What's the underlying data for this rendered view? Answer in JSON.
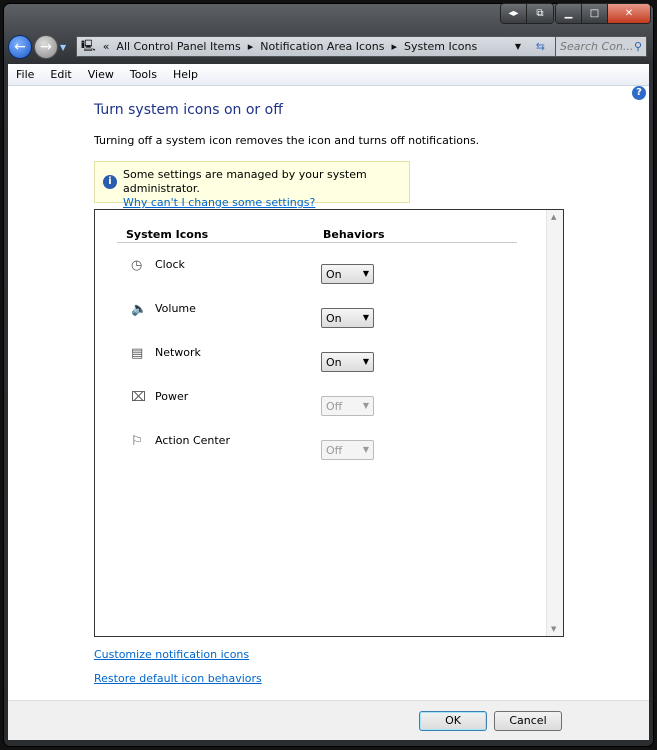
{
  "window": {
    "caption_buttons": [
      "restore-layout",
      "snap",
      "minimize",
      "maximize",
      "close"
    ]
  },
  "address": {
    "overflow": "«",
    "crumbs": [
      "All Control Panel Items",
      "Notification Area Icons",
      "System Icons"
    ],
    "search_placeholder": "Search Con..."
  },
  "menu": [
    "File",
    "Edit",
    "View",
    "Tools",
    "Help"
  ],
  "main": {
    "title": "Turn system icons on or off",
    "description": "Turning off a system icon removes the icon and turns off notifications.",
    "info_text": "Some settings are managed by your system administrator.",
    "info_link": "Why can't I change some settings?",
    "col_icons": "System Icons",
    "col_behaviors": "Behaviors",
    "rows": [
      {
        "name": "Clock",
        "icon": "clock-icon",
        "value": "On",
        "enabled": true
      },
      {
        "name": "Volume",
        "icon": "volume-icon",
        "value": "On",
        "enabled": true
      },
      {
        "name": "Network",
        "icon": "network-icon",
        "value": "On",
        "enabled": true
      },
      {
        "name": "Power",
        "icon": "power-icon",
        "value": "Off",
        "enabled": false
      },
      {
        "name": "Action Center",
        "icon": "flag-icon",
        "value": "Off",
        "enabled": false
      }
    ],
    "link_customize": "Customize notification icons",
    "link_restore": "Restore default icon behaviors"
  },
  "footer": {
    "ok": "OK",
    "cancel": "Cancel"
  }
}
